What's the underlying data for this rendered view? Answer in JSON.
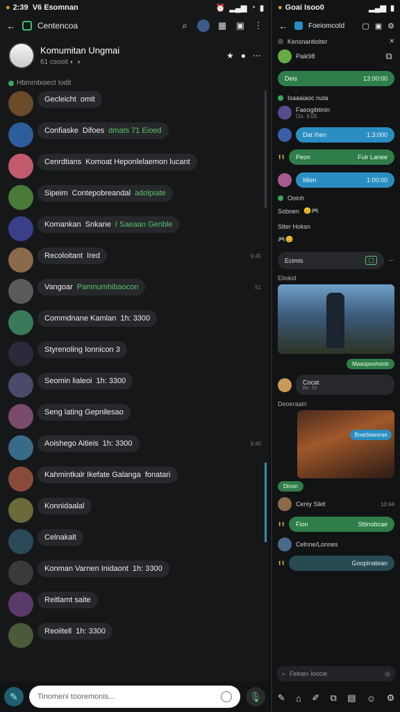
{
  "left": {
    "status": {
      "time": "2:39",
      "carrier": "V6 Esomnan"
    },
    "appbar": {
      "title": "Centencoa"
    },
    "header": {
      "title": "Komumitan Ungmai",
      "sub": "61 csooit"
    },
    "section": "Hbmrnboiect Iodit",
    "chats": [
      {
        "name": "Gecleicht",
        "text": "omit",
        "time": ""
      },
      {
        "name": "Confiaske",
        "text": "Difoes",
        "extra": "dmats 71 Eioed",
        "time": ""
      },
      {
        "name": "Cenrdtians",
        "text": "Komoat Heponlelaemon lucant",
        "time": ""
      },
      {
        "name": "Sipeim",
        "text": "Contepobreandal",
        "extra": "adolpiate",
        "time": ""
      },
      {
        "name": "Komankan",
        "text": "Snkane",
        "extra": "I Saeaan Genble",
        "time": ""
      },
      {
        "name": "Recoloitant",
        "text": "Ired",
        "time": "9:45"
      },
      {
        "name": "Vangoar",
        "text": "Pamnumhibaocon",
        "time": "51"
      },
      {
        "name": "Commdnane Kamlan",
        "text": "1h: 3300",
        "time": ""
      },
      {
        "name": "Styrenoling Ionnicon 3",
        "text": "",
        "time": ""
      },
      {
        "name": "Seomin lialeoi",
        "text": "1h: 3300",
        "time": ""
      },
      {
        "name": "Seng lating Gepnilesao",
        "text": "",
        "time": ""
      },
      {
        "name": "Aoishego Aitieis",
        "text": "1h: 3300",
        "time": "9:45"
      },
      {
        "name": "Kahmintkalr Ikefate Galanga",
        "text": "fonatari",
        "time": ""
      },
      {
        "name": "Konnidaalal",
        "text": "",
        "time": ""
      },
      {
        "name": "Celnakalt",
        "text": "",
        "time": ""
      },
      {
        "name": "Konman Varnen Inidaont",
        "text": "1h: 3300",
        "time": ""
      },
      {
        "name": "Reitlamt saite",
        "text": "",
        "time": ""
      },
      {
        "name": "Reoiitell",
        "text": "1h: 3300",
        "time": ""
      }
    ],
    "composer": {
      "placeholder": "Tinomeni tooremonis..."
    }
  },
  "right": {
    "status": {
      "carrier": "Goai Isoo0"
    },
    "appbar": {
      "title": "Foeiomcotd"
    },
    "pinned": "Kensnantiolter",
    "pinned_sub": "Paik98",
    "msgs": [
      {
        "kind": "green",
        "label": "Deis",
        "value": "13:00:00"
      },
      {
        "kind": "blue",
        "label": "Dat Ihen",
        "value": "1.3:000"
      },
      {
        "kind": "green",
        "label": "Peon",
        "value": "Fuir Lanee"
      },
      {
        "kind": "blue",
        "label": "Mien",
        "value": "1:00:00"
      }
    ],
    "section1": "Isaaaiaoc nuta",
    "user1": "Faeogibtinin",
    "user1_sub": "Oo. 9:05",
    "section2": "Ooinh",
    "dark1": "Sobnen",
    "dark2": "Stter Hoksn",
    "card_label": "Ecimis",
    "section3": "Eliokid",
    "game_caption": "Maaopoohsiotr",
    "comment1": "Cocat",
    "comment1_sub": "Bo. 33",
    "section4": "Deoeraatn",
    "overlay": "Boarbiaesrae",
    "chip": "Dinon",
    "user2": "Ceniy Sikit",
    "user2_time": "10:44",
    "btn2_left": "Fion",
    "btn2_right": "Sttinobcae",
    "user3": "Celnne/Lonnes",
    "teal": "Goopinatean",
    "search": "Felnen Ioocie"
  },
  "colors": {
    "accent": "#3ba55c",
    "blue": "#2b8ec2",
    "bg": "#161719"
  }
}
